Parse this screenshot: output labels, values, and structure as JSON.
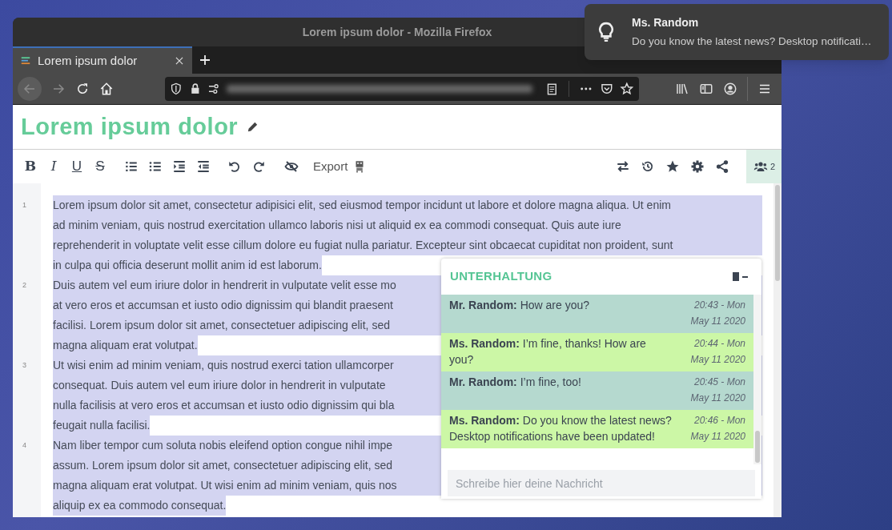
{
  "window": {
    "title": "Lorem ipsum dolor - Mozilla Firefox"
  },
  "tabs": [
    {
      "label": "Lorem ipsum dolor",
      "selected": true
    }
  ],
  "notification": {
    "title": "Ms. Random",
    "body": "Do you know the latest news? Desktop notificati…"
  },
  "document": {
    "title": "Lorem ipsum dolor"
  },
  "toolbar": {
    "format_buttons": [
      {
        "kind": "bold",
        "label": "B"
      },
      {
        "kind": "italic",
        "label": "I"
      },
      {
        "kind": "underline",
        "label": "U"
      },
      {
        "kind": "strike",
        "label": "S"
      }
    ],
    "export_label": "Export",
    "users_count": "2"
  },
  "paragraphs": [
    {
      "number": "1",
      "lines": [
        "Lorem ipsum dolor sit amet, consectetur adipisici elit, sed eiusmod tempor incidunt ut labore et dolore magna aliqua. Ut enim",
        "ad minim veniam, quis nostrud exercitation ullamco laboris nisi ut aliquid ex ea commodi consequat. Quis aute iure",
        "reprehenderit in voluptate velit esse cillum dolore eu fugiat nulla pariatur. Excepteur sint obcaecat cupiditat non proident, sunt",
        "in culpa qui officia deserunt mollit anim id est laborum."
      ]
    },
    {
      "number": "2",
      "lines": [
        "Duis autem vel eum iriure dolor in hendrerit in vulputate velit esse mo",
        "at vero eros et accumsan et iusto odio dignissim qui blandit praesent",
        "facilisi. Lorem ipsum dolor sit amet, consectetuer adipiscing elit, sed",
        "magna aliquam erat volutpat."
      ]
    },
    {
      "number": "3",
      "lines": [
        "Ut wisi enim ad minim veniam, quis nostrud exerci tation ullamcorper",
        "consequat. Duis autem vel eum iriure dolor in hendrerit in vulputate",
        "nulla facilisis at vero eros et accumsan et iusto odio dignissim qui bla",
        "feugait nulla facilisi."
      ]
    },
    {
      "number": "4",
      "lines": [
        "Nam liber tempor cum soluta nobis eleifend option congue nihil impe",
        "assum. Lorem ipsum dolor sit amet, consectetuer adipiscing elit, sed",
        "magna aliquam erat volutpat. Ut wisi enim ad minim veniam, quis nos",
        "aliquip ex ea commodo consequat."
      ]
    }
  ],
  "chat": {
    "title": "UNTERHALTUNG",
    "placeholder": "Schreibe hier deine Nachricht",
    "messages": [
      {
        "sender": "Mr. Random:",
        "text": "How are you?",
        "time": "20:43 - Mon",
        "date": "May 11 2020",
        "color": "#b5d9cf"
      },
      {
        "sender": "Ms. Random:",
        "text": "I’m fine, thanks! How are you?",
        "time": "20:44 - Mon",
        "date": "May 11 2020",
        "color": "#ccf7a6"
      },
      {
        "sender": "Mr. Random:",
        "text": "I’m fine, too!",
        "time": "20:45 - Mon",
        "date": "May 11 2020",
        "color": "#b5d9cf"
      },
      {
        "sender": "Ms. Random:",
        "text": "Do you know the latest news? Desktop notifications have been updated!",
        "time": "20:46 - Mon",
        "date": "May 11 2020",
        "color": "#ccf7a6"
      }
    ]
  }
}
